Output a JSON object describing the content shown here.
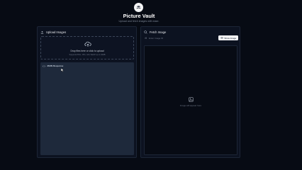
{
  "header": {
    "logo_icon": "stack-layers-icon",
    "title": "Picture Vault",
    "subtitle": "Upload and fetch images with ease."
  },
  "upload_panel": {
    "icon": "upload-icon",
    "title": "Upload Images",
    "dropzone": {
      "icon": "cloud-upload-icon",
      "title": "Drop files here or click to upload",
      "hint": "Supports PNG, JPG, GIF, WebP up to 10MB"
    },
    "response": {
      "icon": "code-icon",
      "label": "JSON Response"
    }
  },
  "fetch_panel": {
    "icon": "search-icon",
    "title": "Fetch Image",
    "input": {
      "icon": "hash-icon",
      "placeholder": "Enter Image ID",
      "value": ""
    },
    "button_label": "Show Image",
    "button_icon": "eye-icon",
    "placeholder_icon": "image-icon",
    "placeholder_text": "Image will appear here"
  },
  "colors": {
    "background": "#070b14",
    "panel": "#0c1220",
    "response_area": "#1e293b",
    "button": "#f3f4f6"
  }
}
